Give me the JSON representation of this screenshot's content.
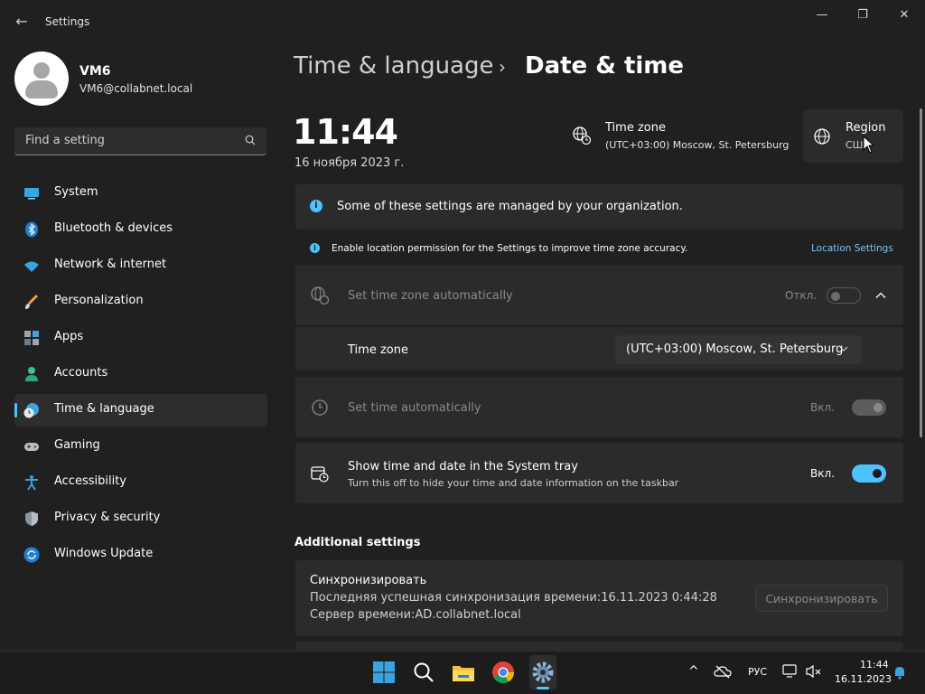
{
  "window": {
    "title": "Settings",
    "back_glyph": "←",
    "minimize_glyph": "—",
    "maximize_glyph": "❐",
    "close_glyph": "✕"
  },
  "user": {
    "name": "VM6",
    "email": "VM6@collabnet.local"
  },
  "search": {
    "placeholder": "Find a setting"
  },
  "sidebar": {
    "items": [
      {
        "label": "System",
        "icon": "monitor-icon"
      },
      {
        "label": "Bluetooth & devices",
        "icon": "bluetooth-icon"
      },
      {
        "label": "Network & internet",
        "icon": "wifi-icon"
      },
      {
        "label": "Personalization",
        "icon": "brush-icon"
      },
      {
        "label": "Apps",
        "icon": "apps-icon"
      },
      {
        "label": "Accounts",
        "icon": "person-icon"
      },
      {
        "label": "Time & language",
        "icon": "clock-globe-icon",
        "active": true
      },
      {
        "label": "Gaming",
        "icon": "gamepad-icon"
      },
      {
        "label": "Accessibility",
        "icon": "accessibility-icon"
      },
      {
        "label": "Privacy & security",
        "icon": "shield-icon"
      },
      {
        "label": "Windows Update",
        "icon": "update-icon"
      }
    ]
  },
  "breadcrumb": {
    "parent": "Time & language",
    "separator": "›",
    "current": "Date & time"
  },
  "summary": {
    "time": "11:44",
    "date": "16 ноября 2023 г.",
    "timezone_title": "Time zone",
    "timezone_value": "(UTC+03:00) Moscow, St. Petersburg",
    "region_title": "Region",
    "region_value": "США"
  },
  "notices": {
    "managed": "Some of these settings are managed by your organization.",
    "location": "Enable location permission for the Settings to improve time zone accuracy.",
    "location_link": "Location Settings",
    "info_glyph": "i"
  },
  "settings": {
    "auto_timezone": {
      "label": "Set time zone automatically",
      "state": "Откл.",
      "on": false
    },
    "timezone": {
      "label": "Time zone",
      "value": "(UTC+03:00) Moscow, St. Petersburg"
    },
    "auto_time": {
      "label": "Set time automatically",
      "state": "Вкл.",
      "on": true
    },
    "tray": {
      "label": "Show time and date in the System tray",
      "description": "Turn this off to hide your time and date information on the taskbar",
      "state": "Вкл.",
      "on": true
    }
  },
  "additional": {
    "title": "Additional settings",
    "sync": {
      "title": "Синхронизировать",
      "last_sync": "Последняя успешная синхронизация времени:16.11.2023 0:44:28",
      "server": "Сервер времени:AD.collabnet.local",
      "button": "Синхронизировать"
    }
  },
  "taskbar": {
    "language": "РУС",
    "time": "11:44",
    "date": "16.11.2023",
    "up_glyph": "^"
  },
  "colors": {
    "accent": "#4cc2ff",
    "background": "#202020",
    "card": "#2b2b2b"
  }
}
